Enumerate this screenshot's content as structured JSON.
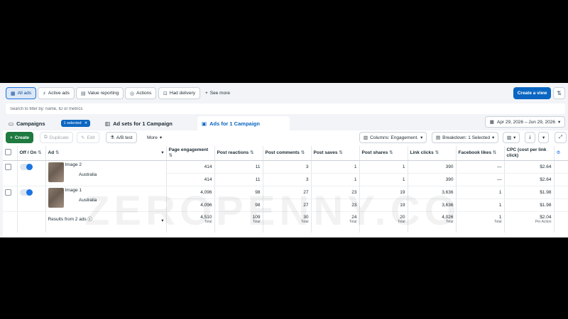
{
  "filters": {
    "all_ads": "All ads",
    "active_ads": "Active ads",
    "value_reporting": "Value reporting",
    "actions": "Actions",
    "had_delivery": "Had delivery",
    "see_more": "See more",
    "create_view": "Create a view"
  },
  "search": {
    "placeholder": "Search to filter by: name, ID or metrics"
  },
  "tabs": {
    "campaigns": "Campaigns",
    "selected_badge": "1 selected",
    "ad_sets": "Ad sets for 1 Campaign",
    "ads": "Ads for 1 Campaign"
  },
  "date_range": "Apr 29, 2026 – Jun 29, 2026",
  "toolbar": {
    "create": "Create",
    "duplicate": "Duplicate",
    "edit": "Edit",
    "ab_test": "A/B test",
    "more": "More",
    "columns": "Columns: Engagement.",
    "breakdown": "Breakdown: 1 Selected"
  },
  "table": {
    "headers": {
      "off_on": "Off / On",
      "ad": "Ad",
      "page_engagement": "Page engagement",
      "post_reactions": "Post reactions",
      "post_comments": "Post comments",
      "post_saves": "Post saves",
      "post_shares": "Post shares",
      "link_clicks": "Link clicks",
      "facebook_likes": "Facebook likes",
      "cpc": "CPC (cost per link click)"
    },
    "rows": [
      {
        "name": "Image 2",
        "main": [
          "414",
          "11",
          "3",
          "1",
          "1",
          "390",
          "—",
          "$2.64"
        ],
        "breakdown_label": "Australia",
        "breakdown": [
          "414",
          "11",
          "3",
          "1",
          "1",
          "390",
          "—",
          "$2.64"
        ]
      },
      {
        "name": "Image 1",
        "main": [
          "4,096",
          "98",
          "27",
          "23",
          "19",
          "3,636",
          "1",
          "$1.98"
        ],
        "breakdown_label": "Australia",
        "breakdown": [
          "4,096",
          "98",
          "27",
          "23",
          "19",
          "3,636",
          "1",
          "$1.98"
        ]
      }
    ],
    "totals": {
      "label": "Results from 2 ads",
      "values": [
        "4,510",
        "109",
        "30",
        "24",
        "20",
        "4,026",
        "1",
        "$2.04"
      ],
      "sublabels": [
        "Total",
        "Total",
        "Total",
        "Total",
        "Total",
        "Total",
        "Total",
        "Per Action"
      ]
    }
  },
  "watermark": "ZEROPENNY.CO",
  "colors": {
    "primary": "#0a66c2",
    "create_green": "#1f7a3f",
    "toggle_on": "#1b74e4"
  }
}
